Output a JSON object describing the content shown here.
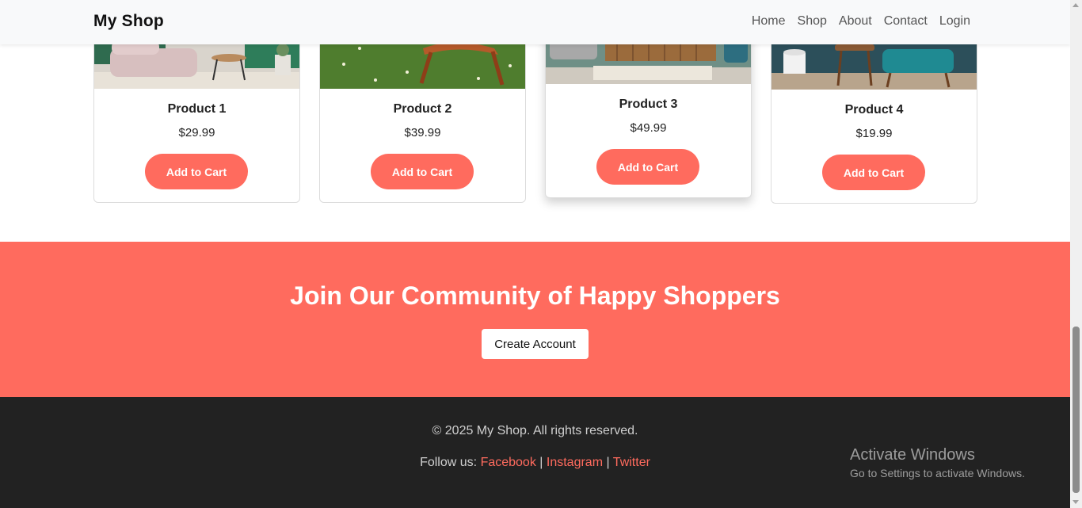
{
  "nav": {
    "brand": "My Shop",
    "links": [
      "Home",
      "Shop",
      "About",
      "Contact",
      "Login"
    ]
  },
  "products": [
    {
      "name": "Product 1",
      "price": "$29.99",
      "button": "Add to Cart"
    },
    {
      "name": "Product 2",
      "price": "$39.99",
      "button": "Add to Cart"
    },
    {
      "name": "Product 3",
      "price": "$49.99",
      "button": "Add to Cart"
    },
    {
      "name": "Product 4",
      "price": "$19.99",
      "button": "Add to Cart"
    }
  ],
  "cta": {
    "title": "Join Our Community of Happy Shoppers",
    "button": "Create Account"
  },
  "footer": {
    "copyright": "© 2025 My Shop. All rights reserved.",
    "follow_label": "Follow us:",
    "social": [
      "Facebook",
      "Instagram",
      "Twitter"
    ],
    "separator": "|"
  },
  "watermark": {
    "title": "Activate Windows",
    "subtitle": "Go to Settings to activate Windows."
  },
  "colors": {
    "accent": "#ff6b5e",
    "footer_bg": "#222222",
    "navbar_bg": "#f8f9fa"
  }
}
